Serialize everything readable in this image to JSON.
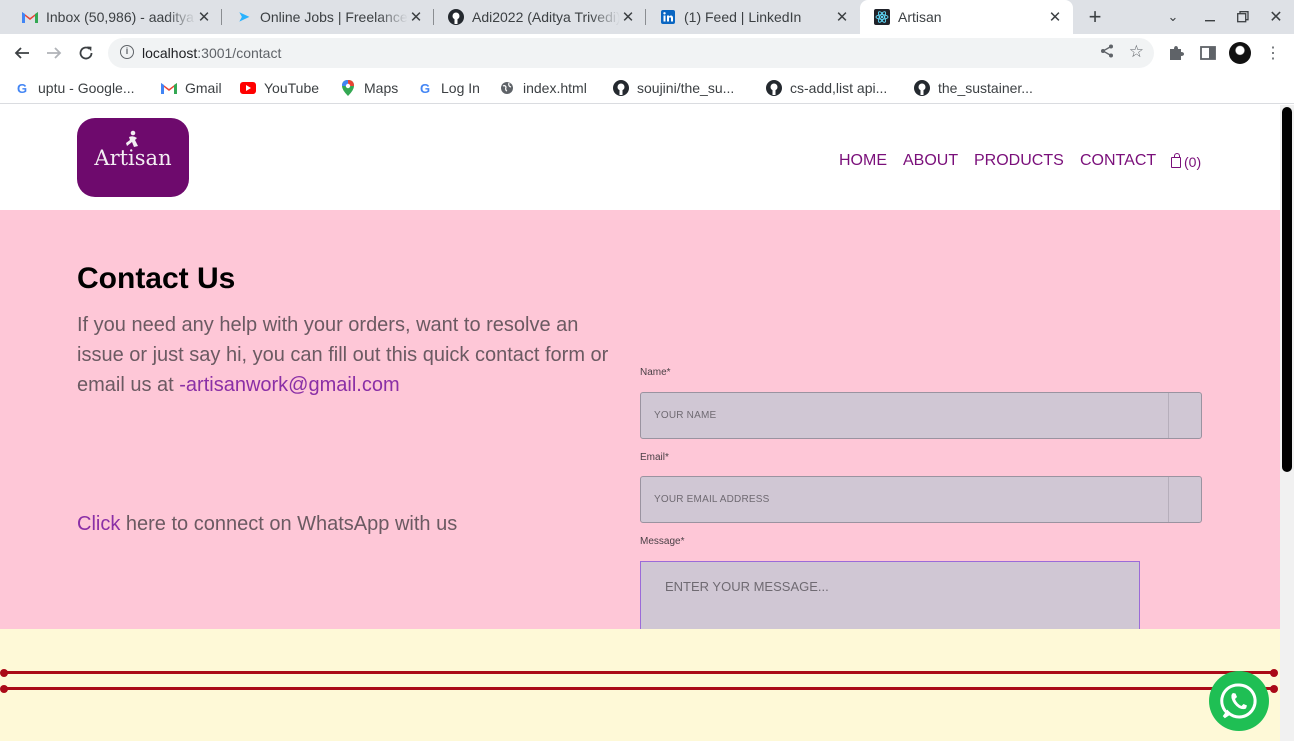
{
  "browser": {
    "tabs": [
      {
        "title": "Inbox (50,986) - aaditya",
        "icon": "gmail-icon"
      },
      {
        "title": "Online Jobs | Freelancer",
        "icon": "freelancer-icon"
      },
      {
        "title": "Adi2022 (Aditya Trivedi)",
        "icon": "github-icon"
      },
      {
        "title": "(1) Feed | LinkedIn",
        "icon": "linkedin-icon"
      },
      {
        "title": "Artisan",
        "icon": "react-icon"
      }
    ],
    "new_tab": "+",
    "url_host": "localhost",
    "url_path": ":3001/contact",
    "bookmarks": [
      {
        "label": "uptu - Google...",
        "icon": "google-icon"
      },
      {
        "label": "Gmail",
        "icon": "gmail-icon"
      },
      {
        "label": "YouTube",
        "icon": "youtube-icon"
      },
      {
        "label": "Maps",
        "icon": "maps-icon"
      },
      {
        "label": "Log In",
        "icon": "google-icon"
      },
      {
        "label": "index.html",
        "icon": "globe-icon"
      },
      {
        "label": "soujini/the_su...",
        "icon": "github-icon"
      },
      {
        "label": "cs-add,list api...",
        "icon": "github-icon"
      },
      {
        "label": "the_sustainer...",
        "icon": "github-icon"
      }
    ]
  },
  "site": {
    "logo_text": "Artisan",
    "nav": [
      "HOME",
      "ABOUT",
      "PRODUCTS",
      "CONTACT"
    ],
    "cart_count": "(0)"
  },
  "contact": {
    "title": "Contact Us",
    "intro": "If you need any help with your orders, want to resolve an issue or just say hi, you can fill out this quick contact form or email us at ",
    "email": "-artisanwork@gmail.com",
    "whatsapp_link": "Click",
    "whatsapp_text": " here to connect on WhatsApp with us"
  },
  "form": {
    "name_label": "Name*",
    "name_placeholder": "YOUR NAME",
    "email_label": "Email*",
    "email_placeholder": "YOUR EMAIL ADDRESS",
    "message_label": "Message*",
    "message_placeholder": "ENTER YOUR MESSAGE..."
  },
  "colors": {
    "brand": "#6e0a6d",
    "nav": "#7a0f7a",
    "contact_bg": "#fec7d7",
    "footer_bg": "#fef9d7",
    "rule": "#aa0a17",
    "whatsapp": "#1fbf54"
  }
}
